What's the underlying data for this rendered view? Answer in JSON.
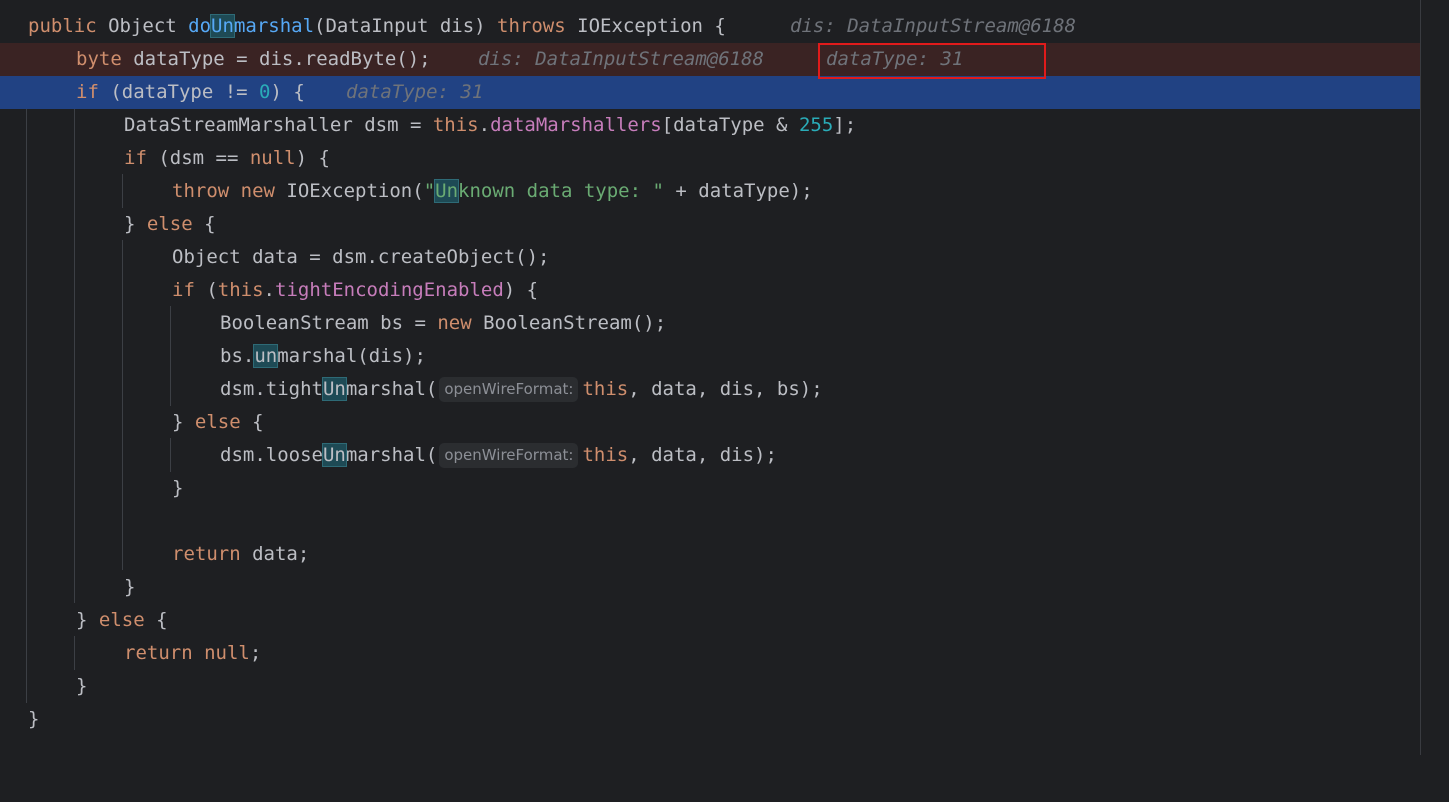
{
  "editor": {
    "lines": {
      "l1": {
        "kw_public": "public ",
        "type": "Object ",
        "method_a": "do",
        "method_b": "Un",
        "method_c": "marshal",
        "params": "(DataInput dis) ",
        "kw_throws": "throws ",
        "exc": "IOException {",
        "hint": "dis: DataInputStream@6188"
      },
      "l2": {
        "kw_byte": "byte ",
        "code": "dataType = dis.readByte();",
        "hint1": "dis: DataInputStream@6188",
        "hint2": "dataType: 31"
      },
      "l3": {
        "kw_if": "if ",
        "code_a": "(dataType != ",
        "num": "0",
        "code_b": ") {",
        "hint": "dataType: 31"
      },
      "l4": {
        "code_a": "DataStreamMarshaller dsm = ",
        "kw_this": "this",
        "dot": ".",
        "field": "dataMarshallers",
        "code_b": "[dataType & ",
        "num": "255",
        "code_c": "];"
      },
      "l5": {
        "kw_if": "if ",
        "code_a": "(dsm == ",
        "kw_null": "null",
        "code_b": ") {"
      },
      "l6": {
        "kw_throw": "throw ",
        "kw_new": "new ",
        "code_a": "IOException(",
        "str_a": "\"",
        "str_b": "Un",
        "str_c": "known data type: \"",
        "code_b": " + dataType);"
      },
      "l7": {
        "code_a": "} ",
        "kw_else": "else",
        "code_b": " {"
      },
      "l8": {
        "code": "Object data = dsm.createObject();"
      },
      "l9": {
        "kw_if": "if ",
        "code_a": "(",
        "kw_this": "this",
        "dot": ".",
        "field": "tightEncodingEnabled",
        "code_b": ") {"
      },
      "l10": {
        "code_a": "BooleanStream bs = ",
        "kw_new": "new ",
        "code_b": "BooleanStream();"
      },
      "l11": {
        "code_a": "bs.",
        "occ": "un",
        "code_b": "marshal(dis);"
      },
      "l12": {
        "code_a": "dsm.tight",
        "occ": "Un",
        "code_b": "marshal(",
        "param_hint": "openWireFormat:",
        "kw_this": "this",
        "code_c": ", data, dis, bs);"
      },
      "l13": {
        "code_a": "} ",
        "kw_else": "else",
        "code_b": " {"
      },
      "l14": {
        "code_a": "dsm.loose",
        "occ": "Un",
        "code_b": "marshal(",
        "param_hint": "openWireFormat:",
        "kw_this": "this",
        "code_c": ", data, dis);"
      },
      "l15": {
        "code": "}"
      },
      "l16": {
        "kw_return": "return ",
        "code": "data;"
      },
      "l17": {
        "code": "}"
      },
      "l18": {
        "code_a": "} ",
        "kw_else": "else",
        "code_b": " {"
      },
      "l19": {
        "kw_return": "return ",
        "kw_null": "null",
        "code": ";"
      },
      "l20": {
        "code": "}"
      },
      "l21": {
        "code": "}"
      }
    }
  },
  "colors": {
    "background": "#1e1f22",
    "keyword": "#cf8e6d",
    "method": "#56a8f5",
    "field": "#c77dbb",
    "number": "#2aacb8",
    "string": "#6aab73",
    "inline_hint": "#6f737a",
    "execution_line": "#3a2323",
    "current_line": "#214283",
    "annotation_box": "#e01b1b"
  }
}
